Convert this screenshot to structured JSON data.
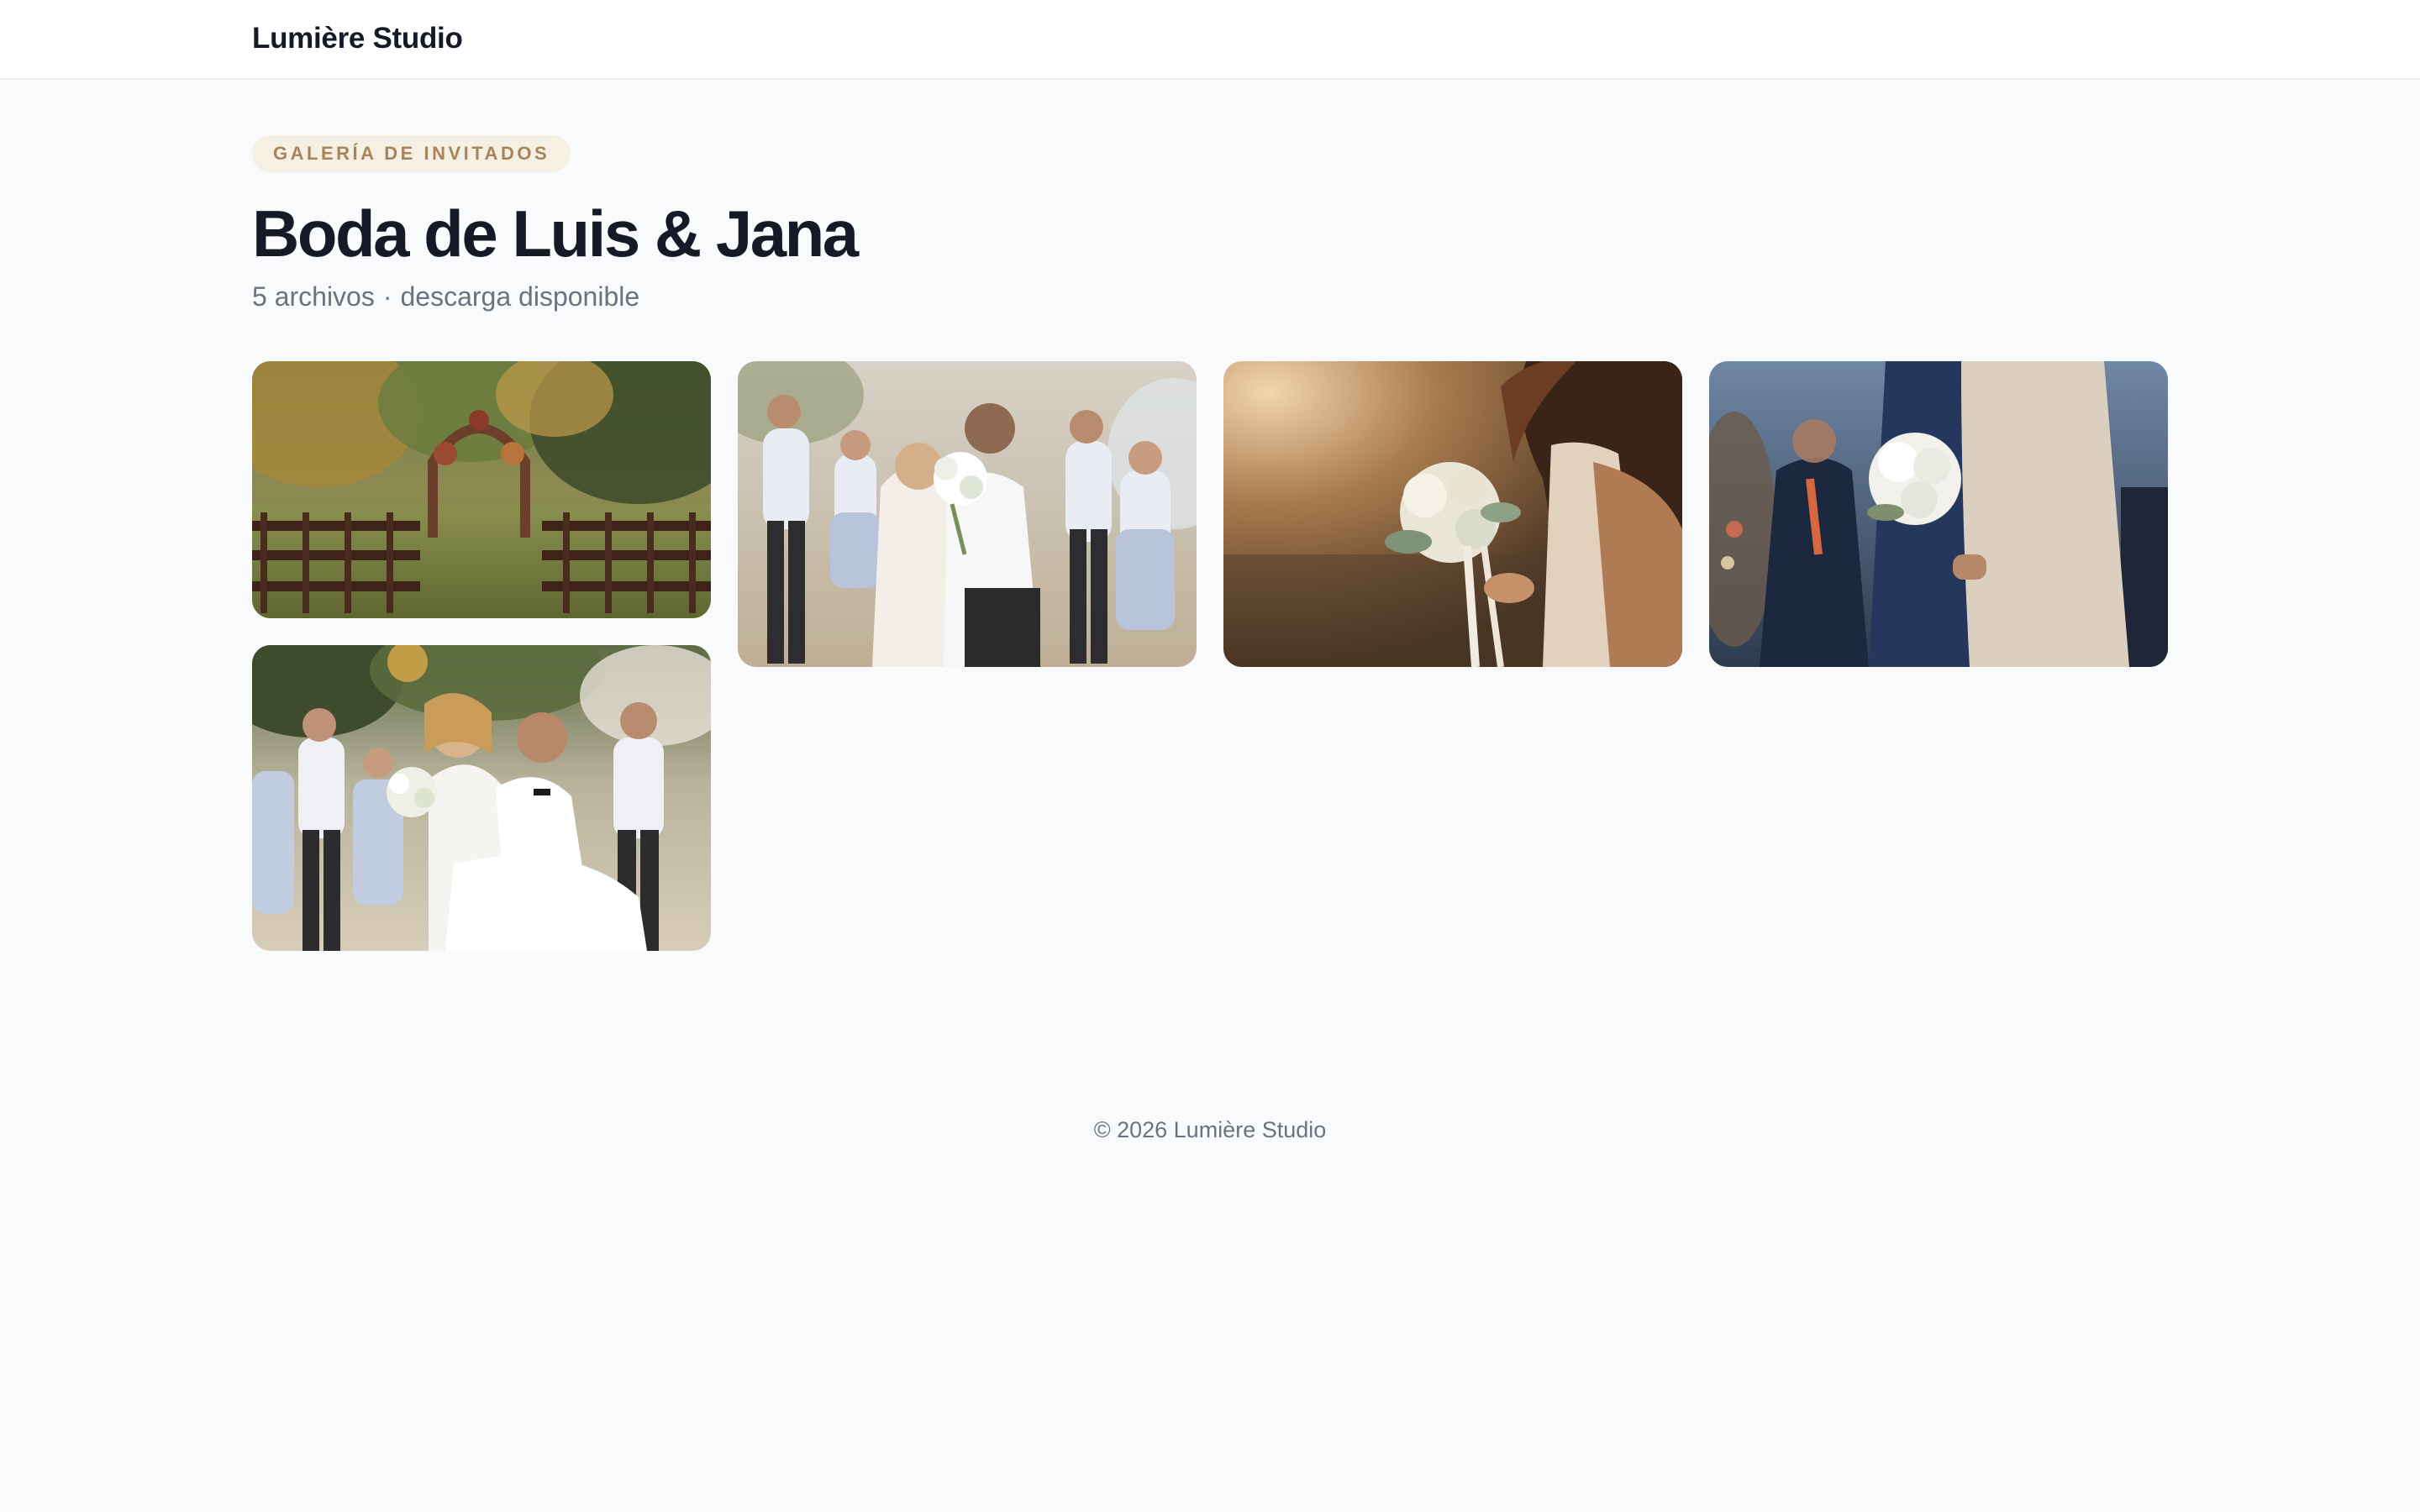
{
  "header": {
    "brand": "Lumière Studio"
  },
  "gallery": {
    "badge": "GALERÍA DE INVITADOS",
    "title": "Boda de Luis & Jana",
    "file_count": "5 archivos",
    "separator": "·",
    "download_status": "descarga disponible"
  },
  "photos": [
    {
      "name": "ceremony-arch-photo"
    },
    {
      "name": "couple-kiss-with-guests-photo"
    },
    {
      "name": "bride-bouquet-sunset-photo"
    },
    {
      "name": "bride-lace-dress-bouquet-photo"
    },
    {
      "name": "groom-carrying-bride-photo"
    }
  ],
  "footer": {
    "copyright": "© 2026 Lumière Studio"
  },
  "colors": {
    "badge_bg": "#f6efe3",
    "badge_text": "#a8845a",
    "title": "#151a26",
    "muted": "#6b7280",
    "page_bg": "#f9fafb"
  }
}
